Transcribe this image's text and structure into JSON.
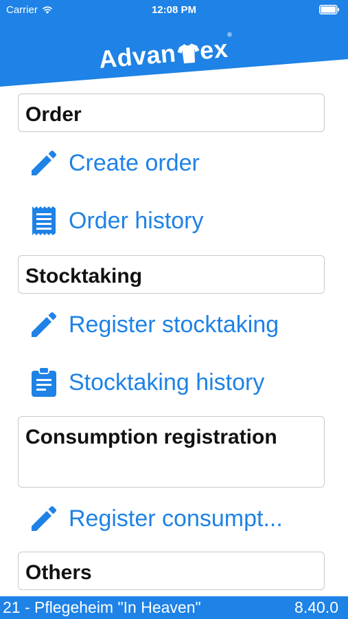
{
  "status_bar": {
    "carrier": "Carrier",
    "time": "12:08 PM"
  },
  "brand": {
    "logo_part1": "Advan",
    "logo_part2": "ex",
    "reg_mark": "®",
    "color": "#1e82e6"
  },
  "sections": [
    {
      "title": "Order",
      "items": [
        {
          "label": "Create order",
          "icon": "pencil-icon"
        },
        {
          "label": "Order history",
          "icon": "receipt-icon"
        }
      ]
    },
    {
      "title": "Stocktaking",
      "items": [
        {
          "label": "Register stocktaking",
          "icon": "pencil-icon"
        },
        {
          "label": "Stocktaking history",
          "icon": "clipboard-icon"
        }
      ]
    },
    {
      "title": "Consumption registration",
      "items": [
        {
          "label": "Register consumpt...",
          "icon": "pencil-icon"
        }
      ]
    },
    {
      "title": "Others",
      "items": []
    }
  ],
  "footer": {
    "site": "21 - Pflegeheim \"In Heaven\"",
    "version": "8.40.0"
  }
}
